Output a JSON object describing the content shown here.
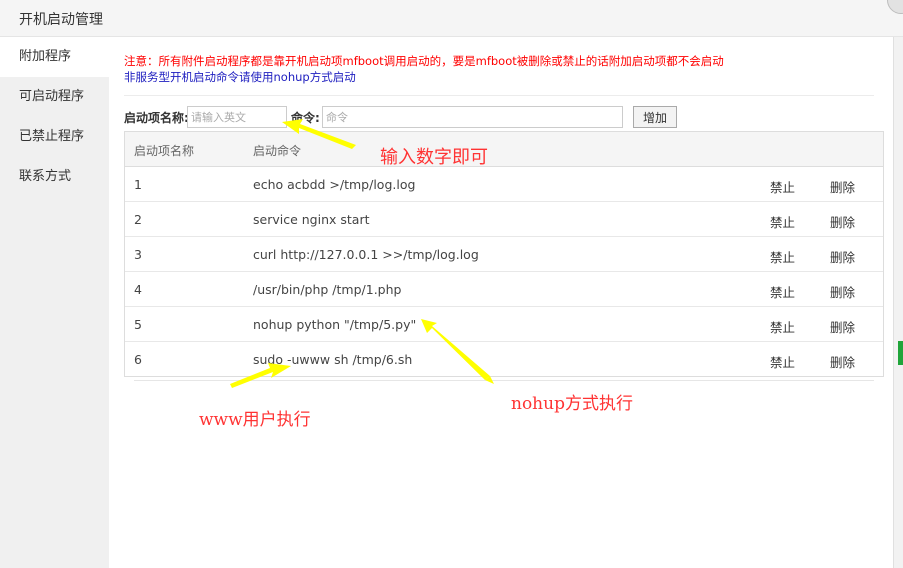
{
  "window": {
    "title": "开机启动管理"
  },
  "sidebar": {
    "items": [
      {
        "label": "附加程序"
      },
      {
        "label": "可启动程序"
      },
      {
        "label": "已禁止程序"
      },
      {
        "label": "联系方式"
      }
    ]
  },
  "notice": {
    "line1": "注意：所有附件启动程序都是靠开机启动项mfboot调用启动的，要是mfboot被删除或禁止的话附加启动项都不会启动",
    "line2": "非服务型开机启动命令请使用nohup方式启动"
  },
  "form": {
    "name_label": "启动项名称:",
    "name_placeholder": "请输入英文",
    "cmd_label": "命令:",
    "cmd_placeholder": "命令",
    "add_label": "增加"
  },
  "table": {
    "headers": [
      "启动项名称",
      "启动命令"
    ],
    "rows": [
      {
        "name": "1",
        "cmd": "echo acbdd >/tmp/log.log",
        "disable": "禁止",
        "delete": "删除"
      },
      {
        "name": "2",
        "cmd": "service nginx start",
        "disable": "禁止",
        "delete": "删除"
      },
      {
        "name": "3",
        "cmd": "curl http://127.0.0.1 >>/tmp/log.log",
        "disable": "禁止",
        "delete": "删除"
      },
      {
        "name": "4",
        "cmd": "/usr/bin/php /tmp/1.php",
        "disable": "禁止",
        "delete": "删除"
      },
      {
        "name": "5",
        "cmd": "nohup python \"/tmp/5.py\"",
        "disable": "禁止",
        "delete": "删除"
      },
      {
        "name": "6",
        "cmd": "sudo -uwww sh /tmp/6.sh",
        "disable": "禁止",
        "delete": "删除"
      }
    ]
  },
  "annotations": {
    "input_numbers": "输入数字即可",
    "www_user": "www用户执行",
    "nohup_mode": "nohup方式执行",
    "arrow_color": "#ffff00",
    "text_color": "#ff3333"
  }
}
